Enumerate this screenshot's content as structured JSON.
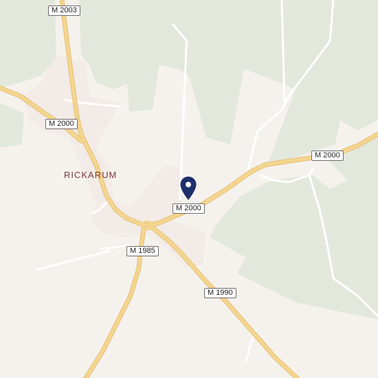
{
  "map": {
    "place_name": "RICKARUM",
    "road_labels": {
      "m2003": "M 2003",
      "m2000_west": "M 2000",
      "m2000_center": "M 2000",
      "m2000_east": "M 2000",
      "m1985": "M 1985",
      "m1990": "M 1990"
    },
    "colors": {
      "background": "#f5f2ee",
      "forest": "#e3e8dc",
      "major_road": "#f3d58f",
      "major_road_casing": "#e6c177",
      "minor_road": "#ffffff",
      "built_up": "#efe6e2",
      "pin": "#1d2f6b"
    },
    "marker_icon": "location-pin-icon"
  }
}
